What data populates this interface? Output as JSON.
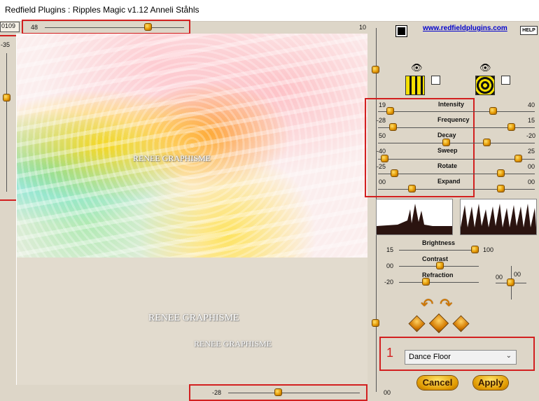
{
  "window": {
    "title": "Redfield Plugins : Ripples Magic v1.12   Anneli Ståhls"
  },
  "left_panel": {
    "top_value": "0109",
    "horiz_slider_value": "48",
    "vert_slider_value": "-35",
    "bottom_slider_value": "-28"
  },
  "right_panel": {
    "top_value": "10",
    "bottom_value": "00",
    "link": "www.redfieldplugins.com",
    "help_label": "HELP",
    "params": [
      {
        "name": "Intensity",
        "left": "19",
        "right": "40"
      },
      {
        "name": "Frequency",
        "left": "-28",
        "right": "15"
      },
      {
        "name": "Decay",
        "left": "50",
        "right": "-20"
      },
      {
        "name": "Sweep",
        "left": "-40",
        "right": "25"
      },
      {
        "name": "Rotate",
        "left": "-25",
        "right": "00"
      },
      {
        "name": "Expand",
        "left": "00",
        "right": "00"
      }
    ],
    "brightness": {
      "label": "Brightness",
      "left": "15",
      "right": "100"
    },
    "contrast": {
      "label": "Contrast",
      "left": "00"
    },
    "refraction": {
      "label": "Refraction",
      "left": "-20"
    },
    "light_pos": {
      "x": "00",
      "y": "00"
    },
    "preset": {
      "selected": "Dance Floor",
      "marker": "1"
    },
    "cancel_label": "Cancel",
    "apply_label": "Apply"
  },
  "preview": {
    "watermark_1": "RENEE GRAPHISME",
    "watermark_2": "RENEE GRAPHISME",
    "watermark_3": "RENEE GRAPHISME"
  },
  "colors": {
    "highlight": "#d22020",
    "panel": "#ddd6c8",
    "thumb": "#e29500"
  },
  "icons": [
    "eye-icon",
    "undo-arrow-icon",
    "redo-arrow-icon",
    "dice-icon"
  ]
}
